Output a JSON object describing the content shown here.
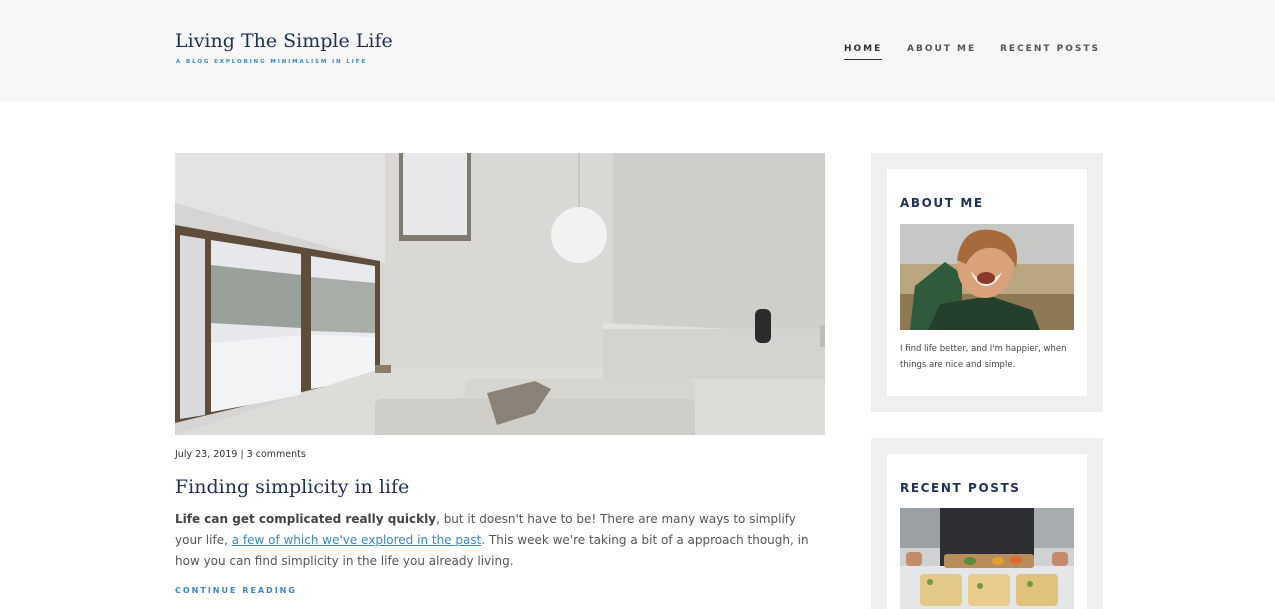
{
  "header": {
    "site_title": "Living The Simple Life",
    "tagline": "A BLOG EXPLORING MINIMALISM IN LIFE",
    "nav": [
      {
        "label": "HOME",
        "active": true
      },
      {
        "label": "ABOUT ME",
        "active": false
      },
      {
        "label": "RECENT POSTS",
        "active": false
      }
    ]
  },
  "post": {
    "date": "July 23, 2019",
    "separator": " | ",
    "comments": "3 comments",
    "title": "Finding simplicity in life",
    "excerpt_bold": "Life can get complicated really quickly",
    "excerpt_part1": ", but it doesn't have to be! There are many ways to simplify your life, ",
    "excerpt_link": "a few of which we've explored in the past",
    "excerpt_part2": ". This week we're taking a bit of a approach though, in how you can find simplicity in the life you already living.",
    "continue_label": "CONTINUE READING"
  },
  "sidebar": {
    "about": {
      "title": "ABOUT ME",
      "text": "I find life better, and I'm happier, when things are nice and simple."
    },
    "recent": {
      "title": "RECENT POSTS"
    }
  },
  "colors": {
    "navy": "#1f3154",
    "accent": "#3b87c4",
    "header_bg": "#f7f7f7",
    "widget_bg": "#efefef"
  }
}
